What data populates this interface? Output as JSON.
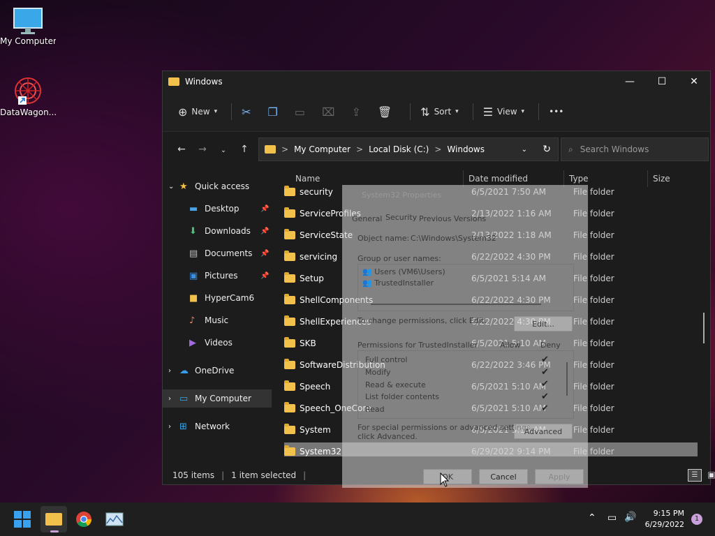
{
  "desktop": {
    "icons": [
      {
        "label": "My Computer"
      },
      {
        "label": "DataWagon..."
      }
    ]
  },
  "window": {
    "title": "Windows",
    "controls": {
      "minimize": "—",
      "maximize": "☐",
      "close": "✕"
    },
    "toolbar": {
      "new_label": "New",
      "sort_label": "Sort",
      "view_label": "View",
      "more_label": "•••"
    },
    "address": {
      "crumbs": [
        "My Computer",
        "Local Disk (C:)",
        "Windows"
      ],
      "sep": ">"
    },
    "search": {
      "placeholder": "Search Windows"
    },
    "sidebar": {
      "quick_access": "Quick access",
      "items": [
        "Desktop",
        "Downloads",
        "Documents",
        "Pictures",
        "HyperCam6",
        "Music",
        "Videos"
      ],
      "onedrive": "OneDrive",
      "my_computer": "My Computer",
      "network": "Network"
    },
    "columns": {
      "name": "Name",
      "date": "Date modified",
      "type": "Type",
      "size": "Size"
    },
    "rows": [
      {
        "name": "security",
        "date": "6/5/2021 7:50 AM",
        "type": "File folder"
      },
      {
        "name": "ServiceProfiles",
        "date": "2/13/2022 1:16 AM",
        "type": "File folder"
      },
      {
        "name": "ServiceState",
        "date": "2/13/2022 1:18 AM",
        "type": "File folder"
      },
      {
        "name": "servicing",
        "date": "6/22/2022 4:30 PM",
        "type": "File folder"
      },
      {
        "name": "Setup",
        "date": "6/5/2021 5:14 AM",
        "type": "File folder"
      },
      {
        "name": "ShellComponents",
        "date": "6/22/2022 4:30 PM",
        "type": "File folder"
      },
      {
        "name": "ShellExperiences",
        "date": "6/22/2022 4:30 PM",
        "type": "File folder"
      },
      {
        "name": "SKB",
        "date": "6/5/2021 5:10 AM",
        "type": "File folder"
      },
      {
        "name": "SoftwareDistribution",
        "date": "6/22/2022 3:46 PM",
        "type": "File folder"
      },
      {
        "name": "Speech",
        "date": "6/5/2021 5:10 AM",
        "type": "File folder"
      },
      {
        "name": "Speech_OneCore",
        "date": "6/5/2021 5:10 AM",
        "type": "File folder"
      },
      {
        "name": "System",
        "date": "6/5/2021 5:10 AM",
        "type": "File folder"
      },
      {
        "name": "System32",
        "date": "6/29/2022 9:14 PM",
        "type": "File folder"
      }
    ],
    "status": {
      "items": "105 items",
      "selected": "1 item selected"
    }
  },
  "dialog": {
    "title": "System32 Properties",
    "tabs": [
      "General",
      "Security",
      "Previous Versions"
    ],
    "object_label": "Object name:",
    "object_value": "C:\\Windows\\System32",
    "group_label": "Group or user names:",
    "users": [
      "Users (VM6\\Users)",
      "TrustedInstaller"
    ],
    "change_text": "To change permissions, click Edit.",
    "edit_btn": "Edit...",
    "perm_label": "Permissions for TrustedInstaller",
    "allow": "Allow",
    "deny": "Deny",
    "perms": [
      "Full control",
      "Modify",
      "Read & execute",
      "List folder contents",
      "Read"
    ],
    "special_text1": "For special permissions or advanced settings,",
    "special_text2": "click Advanced.",
    "advanced_btn": "Advanced",
    "ok_btn": "OK",
    "cancel_btn": "Cancel",
    "apply_btn": "Apply"
  },
  "taskbar": {
    "time": "9:15 PM",
    "date": "6/29/2022",
    "notification_count": "1"
  }
}
